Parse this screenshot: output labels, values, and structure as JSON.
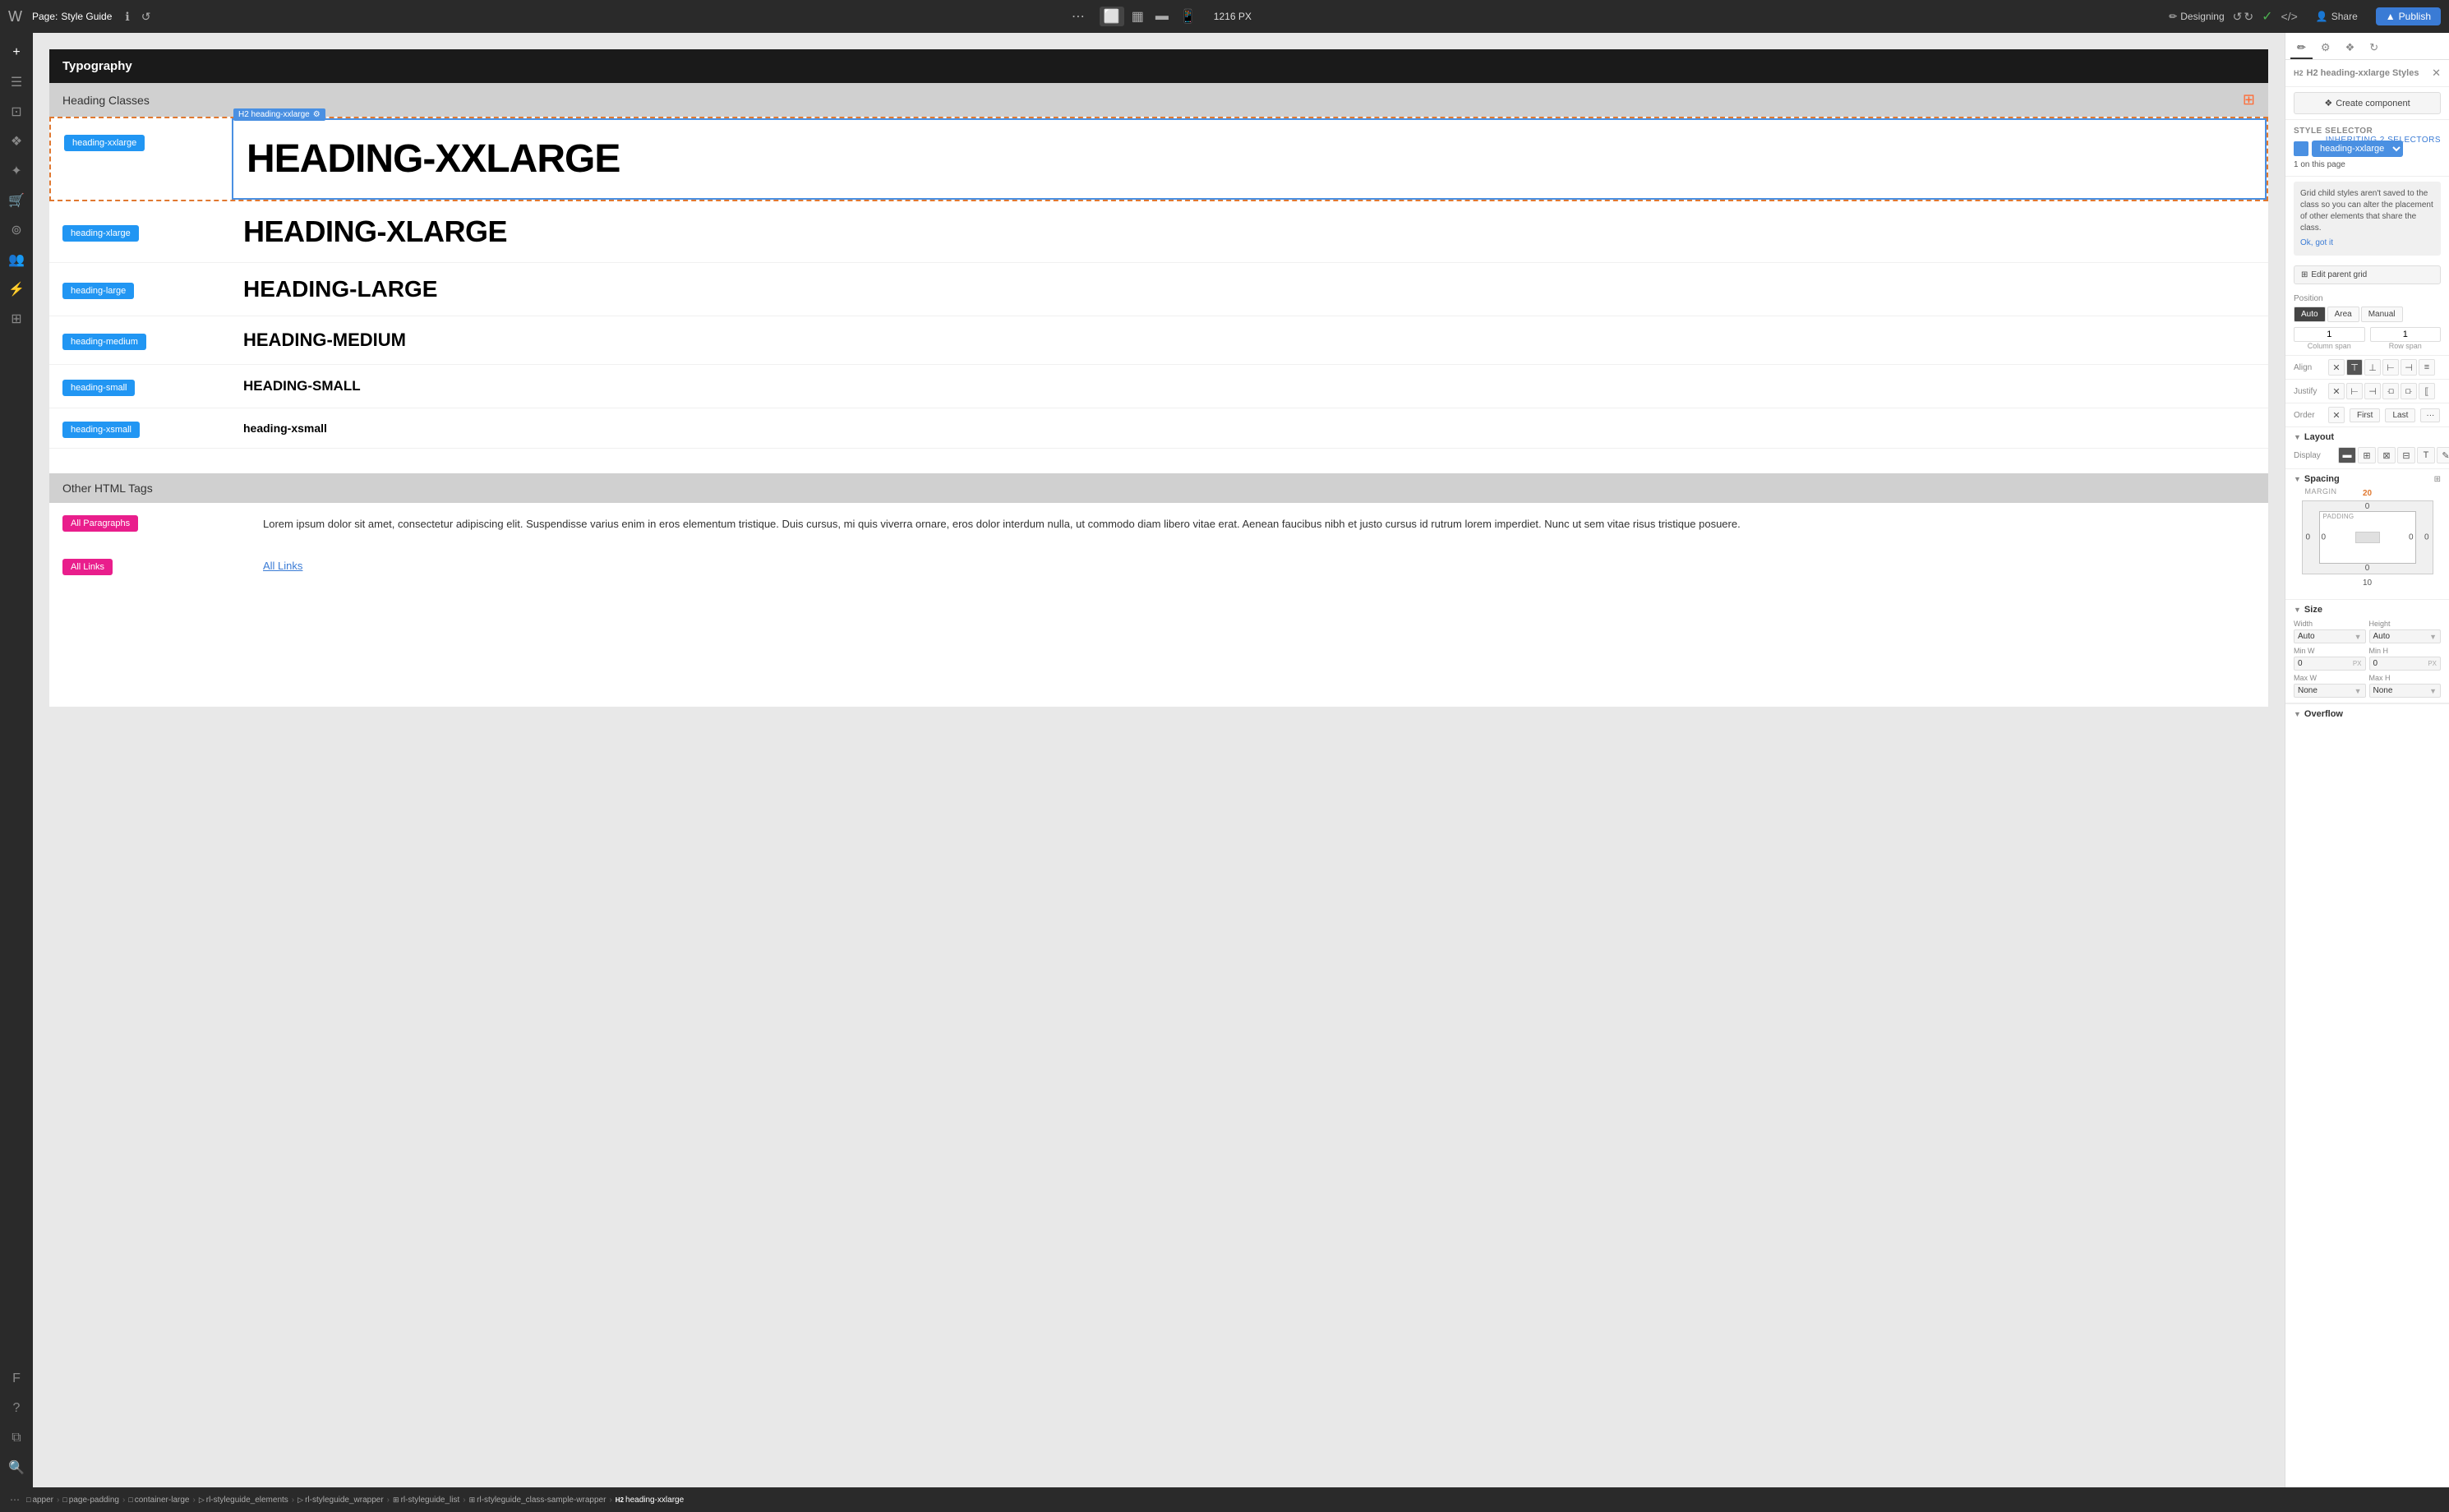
{
  "topbar": {
    "logo": "W",
    "page_label": "Page:",
    "page_name": "Style Guide",
    "history_icon": "↺",
    "pencil_icon": "✎",
    "dots": "⋯",
    "px_value": "1216 PX",
    "designing_label": "Designing",
    "undo_label": "↺",
    "redo_label": "↻",
    "code_label": "</>",
    "share_label": "Share",
    "publish_label": "Publish"
  },
  "sidebar": {
    "icons": [
      "⊞",
      "☰",
      "⊡",
      "⊛",
      "✦",
      "⊕",
      "⊚",
      "⊜",
      "F",
      "?",
      "⧉",
      "⊖"
    ]
  },
  "canvas": {
    "section_title": "Typography",
    "heading_classes_title": "Heading Classes",
    "element_chip": "H2 heading-xxlarge",
    "heading_rows": [
      {
        "badge": "heading-xxlarge",
        "text": "HEADING-XXLARGE",
        "size_class": "h-xxlarge",
        "selected": true
      },
      {
        "badge": "heading-xlarge",
        "text": "HEADING-XLARGE",
        "size_class": "h-xlarge"
      },
      {
        "badge": "heading-large",
        "text": "HEADING-LARGE",
        "size_class": "h-large"
      },
      {
        "badge": "heading-medium",
        "text": "HEADING-MEDIUM",
        "size_class": "h-medium"
      },
      {
        "badge": "heading-small",
        "text": "HEADING-SMALL",
        "size_class": "h-small"
      },
      {
        "badge": "heading-xsmall",
        "text": "heading-xsmall",
        "size_class": "h-xsmall"
      }
    ],
    "other_html_title": "Other HTML Tags",
    "all_paragraphs_badge": "All Paragraphs",
    "paragraph_text": "Lorem ipsum dolor sit amet, consectetur adipiscing elit. Suspendisse varius enim in eros elementum tristique. Duis cursus, mi quis viverra ornare, eros dolor interdum nulla, ut commodo diam libero vitae erat. Aenean faucibus nibh et justo cursus id rutrum lorem imperdiet. Nunc ut sem vitae risus tristique posuere.",
    "all_links_badge": "All Links",
    "links_text": "All Links"
  },
  "right_panel": {
    "tab_style_icon": "✏",
    "tab_settings_icon": "⚙",
    "tab_components_icon": "❖",
    "tab_interact_icon": "⟳",
    "panel_title": "H2 heading-xxlarge Styles",
    "create_component_label": "Create component",
    "style_selector_label": "Style selector",
    "inheriting_label": "Inheriting 2 selectors",
    "style_name": "heading-xxlarge",
    "on_page": "1 on this page",
    "info_text": "Grid child styles aren't saved to the class so you can alter the placement of other elements that share the class.",
    "ok_got_it": "Ok, got it",
    "edit_parent_grid": "Edit parent grid",
    "position_label": "Position",
    "pos_auto": "Auto",
    "pos_area": "Area",
    "pos_manual": "Manual",
    "column_span_label": "Column span",
    "row_span_label": "Row span",
    "column_span_val": "1",
    "row_span_val": "1",
    "align_label": "Align",
    "justify_label": "Justify",
    "order_label": "Order",
    "order_first": "First",
    "order_last": "Last",
    "order_dots": "···",
    "layout_title": "Layout",
    "display_label": "Display",
    "spacing_title": "Spacing",
    "margin_label": "MARGIN",
    "margin_top": "20",
    "margin_bottom": "10",
    "margin_left": "0",
    "margin_right": "0",
    "padding_label": "PADDING",
    "padding_top": "0",
    "padding_bottom": "0",
    "padding_left": "0",
    "padding_right": "0",
    "size_title": "Size",
    "width_label": "Width",
    "height_label": "Height",
    "min_w_label": "Min W",
    "min_h_label": "Min H",
    "max_w_label": "Max W",
    "max_h_label": "Max H",
    "width_val": "Auto",
    "height_val": "Auto",
    "min_w_val": "0",
    "min_h_val": "0",
    "max_w_val": "None",
    "max_h_val": "None",
    "min_w_unit": "PX",
    "min_h_unit": "PX"
  },
  "breadcrumb": {
    "dots": "⋯",
    "items": [
      {
        "icon": "□",
        "label": "apper",
        "type": "box"
      },
      {
        "icon": "□",
        "label": "page-padding",
        "type": "box"
      },
      {
        "icon": "□",
        "label": "container-large",
        "type": "box"
      },
      {
        "icon": "▷",
        "label": "rl-styleguide_elements",
        "type": "list"
      },
      {
        "icon": "▷",
        "label": "rl-styleguide_wrapper",
        "type": "list"
      },
      {
        "icon": "⊞",
        "label": "rl-styleguide_list",
        "type": "grid"
      },
      {
        "icon": "⊞",
        "label": "rl-styleguide_class-sample-wrapper",
        "type": "grid"
      },
      {
        "icon": "H2",
        "label": "heading-xxlarge",
        "type": "h2",
        "current": true
      }
    ]
  }
}
